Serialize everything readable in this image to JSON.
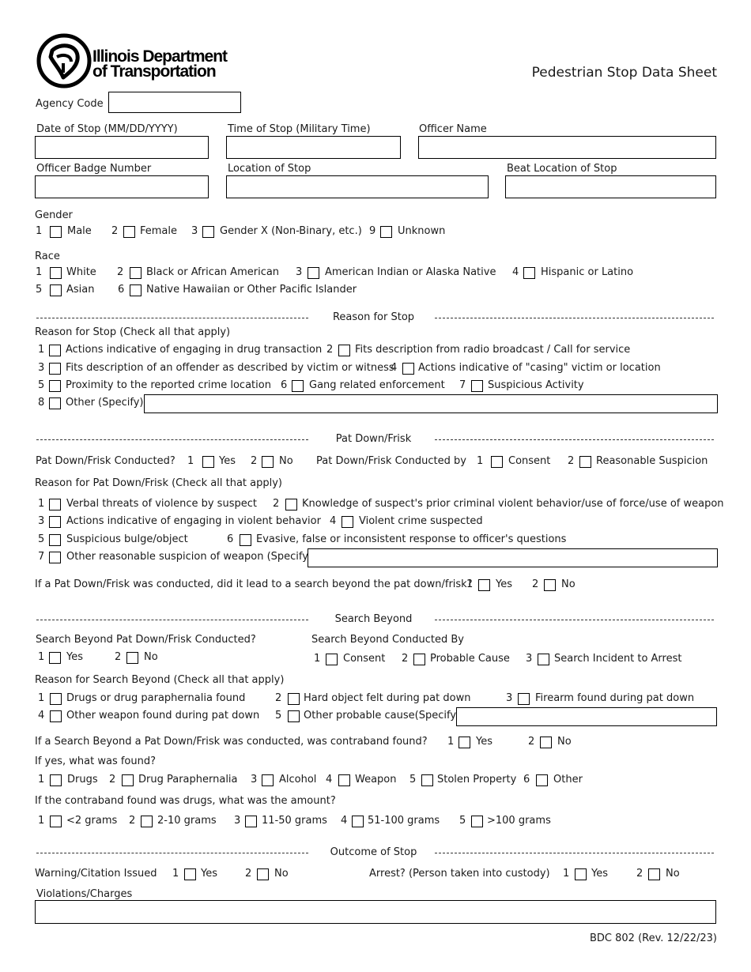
{
  "header": {
    "org_line1": "Illinois Department",
    "org_line2": "of Transportation",
    "form_title": "Pedestrian Stop Data Sheet"
  },
  "fields": {
    "agency_code": {
      "label": "Agency Code",
      "value": ""
    },
    "date_of_stop": {
      "label": "Date of Stop (MM/DD/YYYY)",
      "value": ""
    },
    "time_of_stop": {
      "label": "Time of Stop (Military Time)",
      "value": ""
    },
    "officer_name": {
      "label": "Officer Name",
      "value": ""
    },
    "badge_number": {
      "label": "Officer Badge Number",
      "value": ""
    },
    "location_of_stop": {
      "label": "Location of Stop",
      "value": ""
    },
    "beat_location": {
      "label": "Beat Location of Stop",
      "value": ""
    }
  },
  "gender": {
    "label": "Gender",
    "options": [
      {
        "num": "1",
        "label": "Male"
      },
      {
        "num": "2",
        "label": "Female"
      },
      {
        "num": "3",
        "label": "Gender X (Non-Binary, etc.)"
      },
      {
        "num": "9",
        "label": "Unknown"
      }
    ]
  },
  "race": {
    "label": "Race",
    "options": [
      {
        "num": "1",
        "label": "White"
      },
      {
        "num": "2",
        "label": "Black or African American"
      },
      {
        "num": "3",
        "label": "American Indian or Alaska Native"
      },
      {
        "num": "4",
        "label": "Hispanic or Latino"
      },
      {
        "num": "5",
        "label": "Asian"
      },
      {
        "num": "6",
        "label": "Native Hawaiian or Other Pacific Islander"
      }
    ]
  },
  "reason_for_stop": {
    "section_title": "Reason for Stop",
    "label": "Reason for Stop (Check all that apply)",
    "options": [
      {
        "num": "1",
        "label": "Actions indicative of engaging in drug transaction"
      },
      {
        "num": "2",
        "label": "Fits description from radio broadcast / Call for service"
      },
      {
        "num": "3",
        "label": "Fits description of an offender as described by victim or witness"
      },
      {
        "num": "4",
        "label": "Actions indicative of \"casing\" victim or location"
      },
      {
        "num": "5",
        "label": "Proximity to the reported crime location"
      },
      {
        "num": "6",
        "label": "Gang related enforcement"
      },
      {
        "num": "7",
        "label": "Suspicious Activity"
      },
      {
        "num": "8",
        "label": "Other (Specify)"
      }
    ],
    "other_value": ""
  },
  "pat_down": {
    "section_title": "Pat Down/Frisk",
    "conducted_label": "Pat Down/Frisk Conducted?",
    "conducted_options": [
      {
        "num": "1",
        "label": "Yes"
      },
      {
        "num": "2",
        "label": "No"
      }
    ],
    "conducted_by_label": "Pat Down/Frisk Conducted by",
    "conducted_by_options": [
      {
        "num": "1",
        "label": "Consent"
      },
      {
        "num": "2",
        "label": "Reasonable Suspicion"
      }
    ],
    "reason_label": "Reason for Pat Down/Frisk (Check all that apply)",
    "reasons": [
      {
        "num": "1",
        "label": "Verbal threats of violence by suspect"
      },
      {
        "num": "2",
        "label": "Knowledge of suspect's prior criminal violent behavior/use of force/use of weapon"
      },
      {
        "num": "3",
        "label": "Actions indicative of engaging in violent behavior"
      },
      {
        "num": "4",
        "label": "Violent crime suspected"
      },
      {
        "num": "5",
        "label": "Suspicious bulge/object"
      },
      {
        "num": "6",
        "label": "Evasive, false or inconsistent response to officer's questions"
      },
      {
        "num": "7",
        "label": "Other reasonable suspicion of weapon (Specify)"
      }
    ],
    "other_value": "",
    "lead_question": "If a Pat Down/Frisk was conducted, did it lead to a search beyond the pat down/frisk?",
    "lead_options": [
      {
        "num": "1",
        "label": "Yes"
      },
      {
        "num": "2",
        "label": "No"
      }
    ]
  },
  "search_beyond": {
    "section_title": "Search Beyond",
    "conducted_label": "Search Beyond Pat Down/Frisk Conducted?",
    "conducted_options": [
      {
        "num": "1",
        "label": "Yes"
      },
      {
        "num": "2",
        "label": "No"
      }
    ],
    "conducted_by_label": "Search Beyond Conducted By",
    "conducted_by_options": [
      {
        "num": "1",
        "label": "Consent"
      },
      {
        "num": "2",
        "label": "Probable Cause"
      },
      {
        "num": "3",
        "label": "Search Incident to Arrest"
      }
    ],
    "reason_label": "Reason for Search Beyond (Check all that apply)",
    "reasons": [
      {
        "num": "1",
        "label": "Drugs or drug paraphernalia found"
      },
      {
        "num": "2",
        "label": "Hard object felt during pat down"
      },
      {
        "num": "3",
        "label": "Firearm found during pat down"
      },
      {
        "num": "4",
        "label": "Other weapon found during pat down"
      },
      {
        "num": "5",
        "label": "Other probable cause(Specify)"
      }
    ],
    "other_value": "",
    "contraband_question": "If a Search Beyond a Pat Down/Frisk was conducted, was contraband found?",
    "contraband_options": [
      {
        "num": "1",
        "label": "Yes"
      },
      {
        "num": "2",
        "label": "No"
      }
    ],
    "found_question": "If yes, what was found?",
    "found_options": [
      {
        "num": "1",
        "label": "Drugs"
      },
      {
        "num": "2",
        "label": "Drug Paraphernalia"
      },
      {
        "num": "3",
        "label": "Alcohol"
      },
      {
        "num": "4",
        "label": "Weapon"
      },
      {
        "num": "5",
        "label": "Stolen Property"
      },
      {
        "num": "6",
        "label": "Other"
      }
    ],
    "amount_question": "If the contraband found was drugs, what was the amount?",
    "amount_options": [
      {
        "num": "1",
        "label": "<2 grams"
      },
      {
        "num": "2",
        "label": "2-10 grams"
      },
      {
        "num": "3",
        "label": "11-50 grams"
      },
      {
        "num": "4",
        "label": "51-100 grams"
      },
      {
        "num": "5",
        "label": ">100 grams"
      }
    ]
  },
  "outcome": {
    "section_title": "Outcome of Stop",
    "warning_label": "Warning/Citation Issued",
    "warning_options": [
      {
        "num": "1",
        "label": "Yes"
      },
      {
        "num": "2",
        "label": "No"
      }
    ],
    "arrest_label": "Arrest? (Person taken into custody)",
    "arrest_options": [
      {
        "num": "1",
        "label": "Yes"
      },
      {
        "num": "2",
        "label": "No"
      }
    ],
    "violations_label": "Violations/Charges",
    "violations_value": ""
  },
  "footer": {
    "form_id": "BDC 802 (Rev. 12/22/23)"
  }
}
